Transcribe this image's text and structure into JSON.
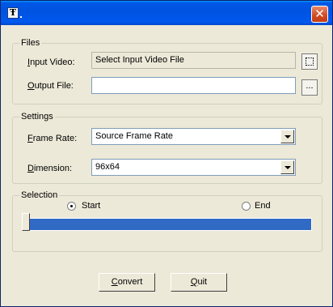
{
  "window": {
    "close_glyph": "✕",
    "app_icon": "app-icon"
  },
  "files": {
    "legend": "Files",
    "input_video_label": "Input Video:",
    "input_video_value": "Select Input Video File",
    "output_file_label": "Output File:",
    "output_file_value": "",
    "output_browse_label": "..."
  },
  "settings": {
    "legend": "Settings",
    "frame_rate_label": "Frame Rate:",
    "frame_rate_value": "Source Frame Rate",
    "dimension_label": "Dimension:",
    "dimension_value": "96x64"
  },
  "selection": {
    "legend": "Selection",
    "start_label": "Start",
    "end_label": "End",
    "selected": "Start",
    "slider_position": 0
  },
  "buttons": {
    "convert_label": "Convert",
    "quit_label": "Quit"
  },
  "colors": {
    "title_bar": "#0058e6",
    "slider_track": "#316ac5",
    "window_bg": "#ece9d8",
    "close_button": "#d04a22"
  }
}
